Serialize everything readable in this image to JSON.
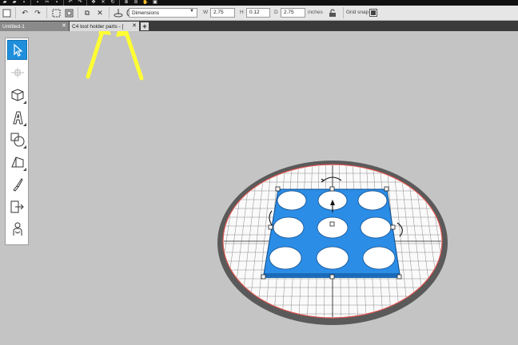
{
  "icons": {
    "top_strip": [
      "folder-open-icon",
      "folder-icon",
      "save-icon",
      "print-icon",
      "scissors-icon",
      "trash-icon",
      "undo-icon",
      "redo-icon",
      "pan-icon",
      "move-icon",
      "rotate-icon",
      "zoom-in-icon",
      "zoom-out-icon",
      "hand-icon",
      "fit-icon"
    ],
    "toolbar": [
      "select-box-icon",
      "undo-icon",
      "redo-icon",
      "group-icon",
      "ungroup-icon",
      "copy-icon",
      "delete-icon",
      "drop-to-base-icon",
      "center-icon"
    ]
  },
  "toolbar": {
    "dimensions_select": "Dimensions",
    "width_label": "W",
    "width_value": "2.75",
    "height_label": "H",
    "height_value": "0.12",
    "depth_label": "D",
    "depth_value": "2.75",
    "units": "inches",
    "grid_snap_label": "Grid snap"
  },
  "tabs": [
    {
      "label": "Untitled-1",
      "active": false
    },
    {
      "label": "C4 tool holder parts - [",
      "active": true
    }
  ],
  "tools": [
    {
      "name": "select-tool",
      "icon": "cursor-icon",
      "active": true
    },
    {
      "name": "move-tool",
      "icon": "move-arrows-icon",
      "active": false
    },
    {
      "name": "primitives-tool",
      "icon": "cube-icon",
      "active": false
    },
    {
      "name": "text-tool",
      "icon": "text-a-icon",
      "active": false
    },
    {
      "name": "shapes-tool",
      "icon": "shapes-icon",
      "active": false
    },
    {
      "name": "extrude-tool",
      "icon": "extrude-icon",
      "active": false
    },
    {
      "name": "cut-tool",
      "icon": "knife-icon",
      "active": false
    },
    {
      "name": "import-tool",
      "icon": "import-icon",
      "active": false
    },
    {
      "name": "figure-tool",
      "icon": "figure-icon",
      "active": false
    }
  ],
  "colors": {
    "accent": "#1f8fdc",
    "model_blue": "#2b8de6",
    "annotation_arrow": "#ffff33",
    "platform_red": "#d9534f",
    "workspace_bg": "#c4c4c4"
  }
}
